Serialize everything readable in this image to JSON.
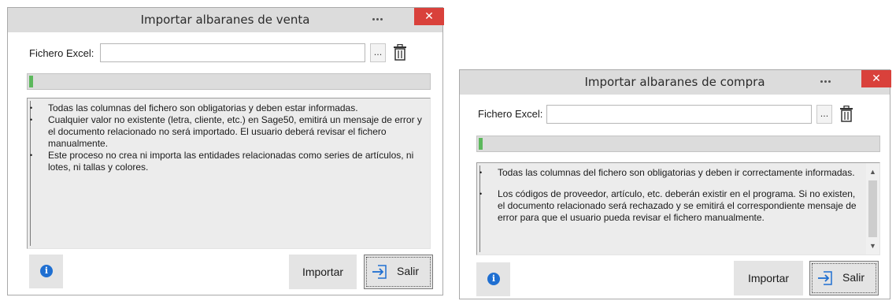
{
  "windows": [
    {
      "title": "Importar albaranes de venta",
      "close_symbol": "✕",
      "file_label": "Fichero Excel:",
      "file_value": "",
      "browse_label": "...",
      "progress_percent": 1,
      "info_items": [
        "Todas las columnas del fichero son obligatorias y deben estar informadas.",
        "Cualquier valor no existente (letra, cliente, etc.) en Sage50, emitirá un mensaje de error y el documento relacionado no será importado. El usuario deberá revisar el fichero manualmente.",
        "Este proceso no crea ni importa las entidades relacionadas como series de artículos, ni lotes, ni tallas y colores."
      ],
      "info_icon_label": "i",
      "import_label": "Importar",
      "exit_label": "Salir"
    },
    {
      "title": "Importar albaranes de compra",
      "close_symbol": "✕",
      "file_label": "Fichero Excel:",
      "file_value": "",
      "browse_label": "...",
      "progress_percent": 1,
      "info_items": [
        "Todas las columnas del fichero son obligatorias y deben ir correctamente informadas.",
        "Los códigos de  proveedor,  artículo, etc. deberán existir en el programa. Si no existen, el documento relacionado será rechazado y se emitirá el correspondiente mensaje de error para que el usuario pueda revisar el fichero manualmente."
      ],
      "scroll_up_symbol": "▲",
      "scroll_down_symbol": "▼",
      "info_icon_label": "i",
      "import_label": "Importar",
      "exit_label": "Salir"
    }
  ],
  "icons": {
    "overflow": "dots-icon",
    "close": "close-icon",
    "delete": "trash-icon",
    "info": "info-icon",
    "exit": "exit-arrow-icon"
  },
  "colors": {
    "titlebar": "#dcdcdc",
    "close": "#d9413b",
    "progress_fill": "#5cb85c",
    "info_blue": "#1f6fd1",
    "button_bg": "#e4e4e4"
  }
}
